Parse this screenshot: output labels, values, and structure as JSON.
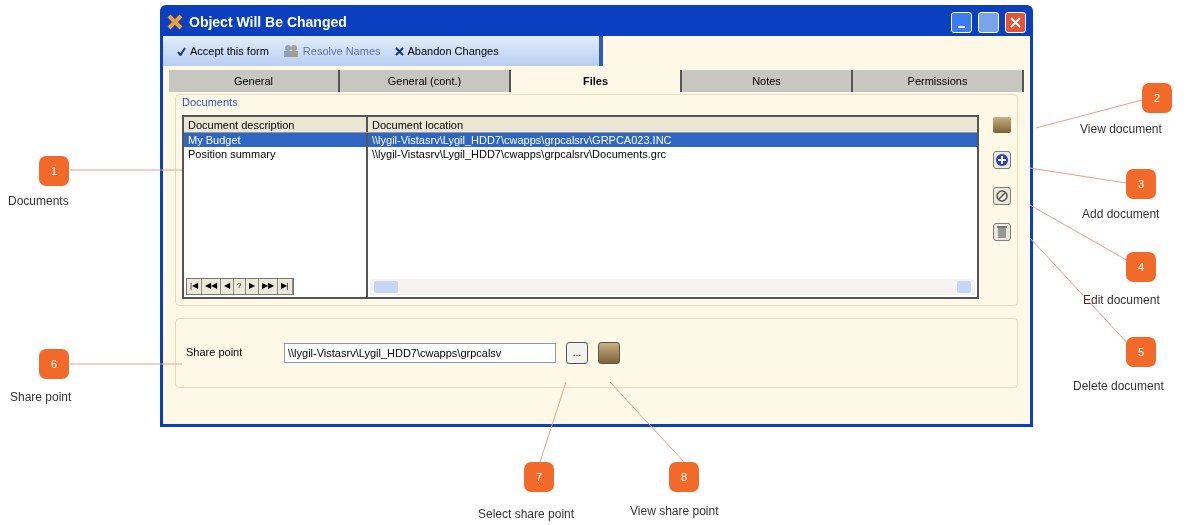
{
  "window": {
    "title": "Object Will Be Changed"
  },
  "toolbar": [
    {
      "label": "Accept this form",
      "disabled": false,
      "kind": "check"
    },
    {
      "label": "Resolve Names",
      "disabled": true,
      "kind": "people"
    },
    {
      "label": "Abandon Changes",
      "disabled": false,
      "kind": "cross"
    }
  ],
  "tabs": [
    {
      "label": "General",
      "selected": false
    },
    {
      "label": "General (cont.)",
      "selected": false
    },
    {
      "label": "Files",
      "selected": true
    },
    {
      "label": "Notes",
      "selected": false
    },
    {
      "label": "Permissions",
      "selected": false
    }
  ],
  "documents": {
    "title": "Documents",
    "columns": [
      "Document description",
      "Document location"
    ],
    "rows": [
      {
        "description": "My Budget",
        "location": "\\\\lygil-Vistasrv\\Lygil_HDD7\\cwapps\\grpcalsrv\\GRPCA023.INC",
        "selected": true
      },
      {
        "description": "Position summary",
        "location": "\\\\lygil-Vistasrv\\Lygil_HDD7\\cwapps\\grpcalsrv\\Documents.grc",
        "selected": false
      }
    ],
    "navigator": [
      "|◀",
      "◀◀",
      "◀",
      "?",
      "▶",
      "▶▶",
      "▶|"
    ]
  },
  "share_point": {
    "label": "Share point",
    "value": "\\\\lygil-Vistasrv\\Lygil_HDD7\\cwapps\\grpcalsv",
    "browse": "..."
  },
  "callouts": [
    {
      "number": "1",
      "label": "Documents"
    },
    {
      "number": "2",
      "label": "View document"
    },
    {
      "number": "3",
      "label": "Add document"
    },
    {
      "number": "4",
      "label": "Edit document"
    },
    {
      "number": "5",
      "label": "Delete document"
    },
    {
      "number": "6",
      "label": "Share point"
    },
    {
      "number": "7",
      "label": "Select share point"
    },
    {
      "number": "8",
      "label": "View share point"
    }
  ]
}
